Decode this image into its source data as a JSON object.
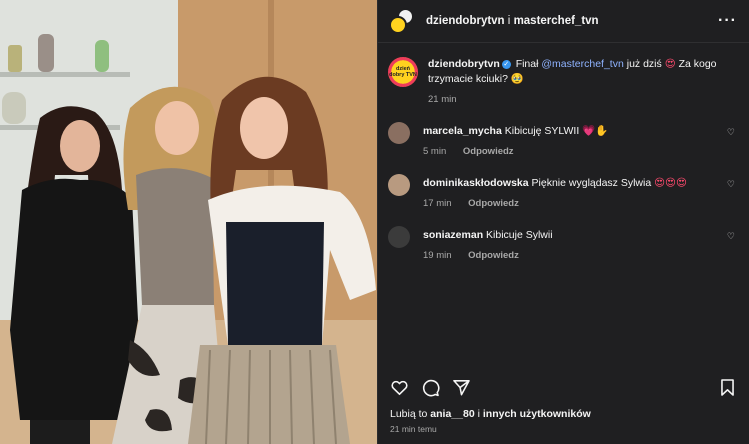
{
  "header": {
    "account_main": "dziendobrytvn",
    "joiner": "i",
    "account_second": "masterchef_tvn",
    "more_icon": "more-horizontal-icon"
  },
  "caption": {
    "avatar_text": "dzień dobry TVN",
    "username": "dziendobrytvn",
    "text_before": "Finał",
    "mention": "@masterchef_tvn",
    "text_after": "już dziś",
    "emoji_1": "😍",
    "text_question": "Za kogo trzymacie kciuki?",
    "emoji_2": "🥹",
    "time": "21 min"
  },
  "comments": [
    {
      "username": "marcela_mycha",
      "text": "Kibicuję SYLWII",
      "emoji": "💗✋",
      "time": "5 min",
      "reply": "Odpowiedz",
      "avatar_color": "#8a6f61"
    },
    {
      "username": "dominikaskłodowska",
      "text": "Pięknie wyglądasz Sylwia",
      "emoji": "😍😍😍",
      "time": "17 min",
      "reply": "Odpowiedz",
      "avatar_color": "#b89a80"
    },
    {
      "username": "soniazeman",
      "text": "Kibicuje Sylwii",
      "emoji": "",
      "time": "19 min",
      "reply": "Odpowiedz",
      "avatar_color": "#3b3b3b"
    }
  ],
  "footer": {
    "likes_prefix": "Lubią to",
    "likes_user": "ania__80",
    "likes_mid": "i",
    "likes_suffix": "innych użytkowników",
    "time": "21 min temu"
  },
  "colors": {
    "panel_bg": "#1f1f21",
    "mention": "#8fb3ff",
    "muted": "#a8a8a8",
    "brand_yellow": "#ffd21f"
  }
}
